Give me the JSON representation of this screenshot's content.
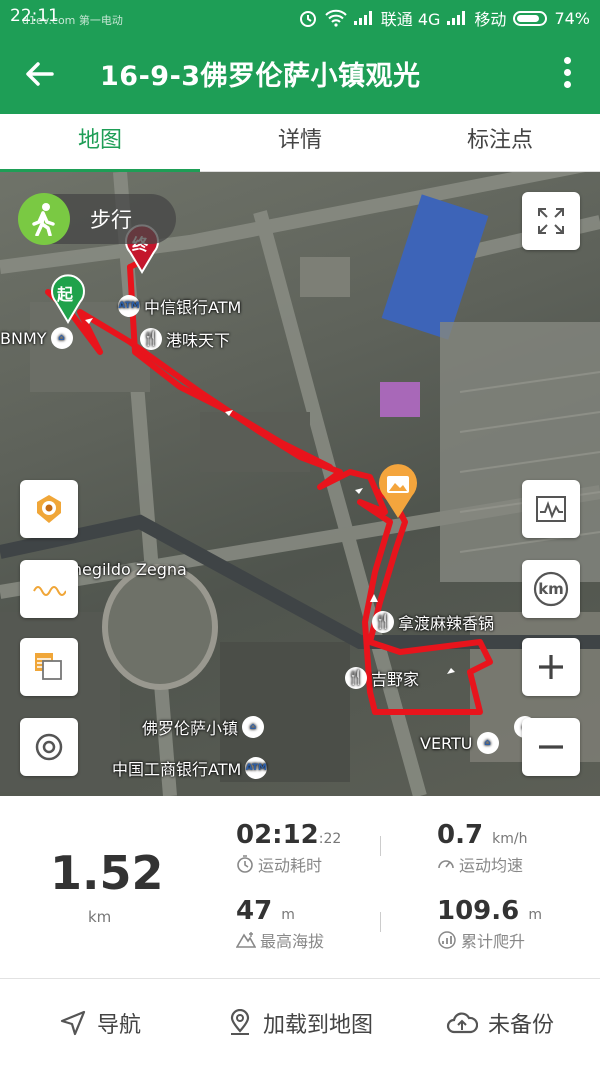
{
  "status_bar": {
    "time": "22:11",
    "watermark": "d1ev.com 第一电动",
    "carrier1": "联通 4G",
    "carrier2": "移动",
    "battery": "74%"
  },
  "app_bar": {
    "title": "16-9-3佛罗伦萨小镇观光"
  },
  "tabs": [
    {
      "label": "地图",
      "active": true
    },
    {
      "label": "详情",
      "active": false
    },
    {
      "label": "标注点",
      "active": false
    }
  ],
  "map": {
    "mode_label": "步行",
    "start_marker": "起",
    "end_marker": "终",
    "labels": {
      "citic_atm": "中信银行ATM",
      "gangwei": "港味天下",
      "bnmy": "BNMY",
      "zegna": "enegildo Zegna",
      "naduma": "拿渡麻辣香锅",
      "yoshinoya": "吉野家",
      "florentia": "佛罗伦萨小镇",
      "vertu": "VERTU",
      "icbc_atm": "中国工商银行ATM",
      "ty": "TY"
    },
    "atm_badge": "ATM",
    "km_button": "km",
    "route_color": "#e8141c"
  },
  "stats": {
    "distance": "1.52",
    "distance_unit": "km",
    "duration_main": "02:12",
    "duration_sec": ":22",
    "duration_label": "运动耗时",
    "speed_value": "0.7",
    "speed_unit": "km/h",
    "speed_label": "运动均速",
    "max_alt_value": "47",
    "max_alt_unit": "m",
    "max_alt_label": "最高海拔",
    "climb_value": "109.6",
    "climb_unit": "m",
    "climb_label": "累计爬升"
  },
  "actions": [
    {
      "label": "导航",
      "icon": "navigation-arrow-icon"
    },
    {
      "label": "加载到地图",
      "icon": "location-pin-icon"
    },
    {
      "label": "未备份",
      "icon": "cloud-upload-icon"
    }
  ]
}
